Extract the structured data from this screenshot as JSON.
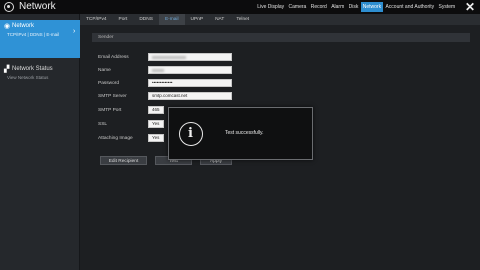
{
  "app": {
    "title": "Network"
  },
  "menu": {
    "items": [
      "Live Display",
      "Camera",
      "Record",
      "Alarm",
      "Disk",
      "Network",
      "Account and Authority",
      "System"
    ],
    "active": "Network"
  },
  "sidebar": {
    "items": [
      {
        "title": "Network",
        "subtitle": "TCP/IPv4 | DDNS | E-mail",
        "icon": "network-icon"
      },
      {
        "title": "Network Status",
        "subtitle": "View Network Status",
        "icon": "status-icon"
      }
    ]
  },
  "tabs": {
    "items": [
      "TCP/IPv4",
      "Port",
      "DDNS",
      "E-mail",
      "UPnP",
      "NAT",
      "Telnet"
    ],
    "active": "E-mail"
  },
  "section": {
    "title": "Sender"
  },
  "form": {
    "email_label": "Email Address",
    "name_label": "Name",
    "password_label": "Password",
    "password_value": "•••••••••••••",
    "smtp_label": "SMTP Server",
    "smtp_value": "smtp.comcast.net",
    "port_label": "SMTP Port",
    "port_value": "465",
    "ssl_label": "SSL",
    "ssl_value": "Yes",
    "attach_label": "Attaching Image",
    "attach_value": "Yes"
  },
  "buttons": {
    "edit_recipient": "Edit Recipient",
    "test": "Test",
    "apply": "Apply"
  },
  "dialog": {
    "message": "Test successfully.",
    "icon": "info-icon"
  },
  "colors": {
    "accent": "#2f92d6",
    "background": "#1e2023"
  }
}
